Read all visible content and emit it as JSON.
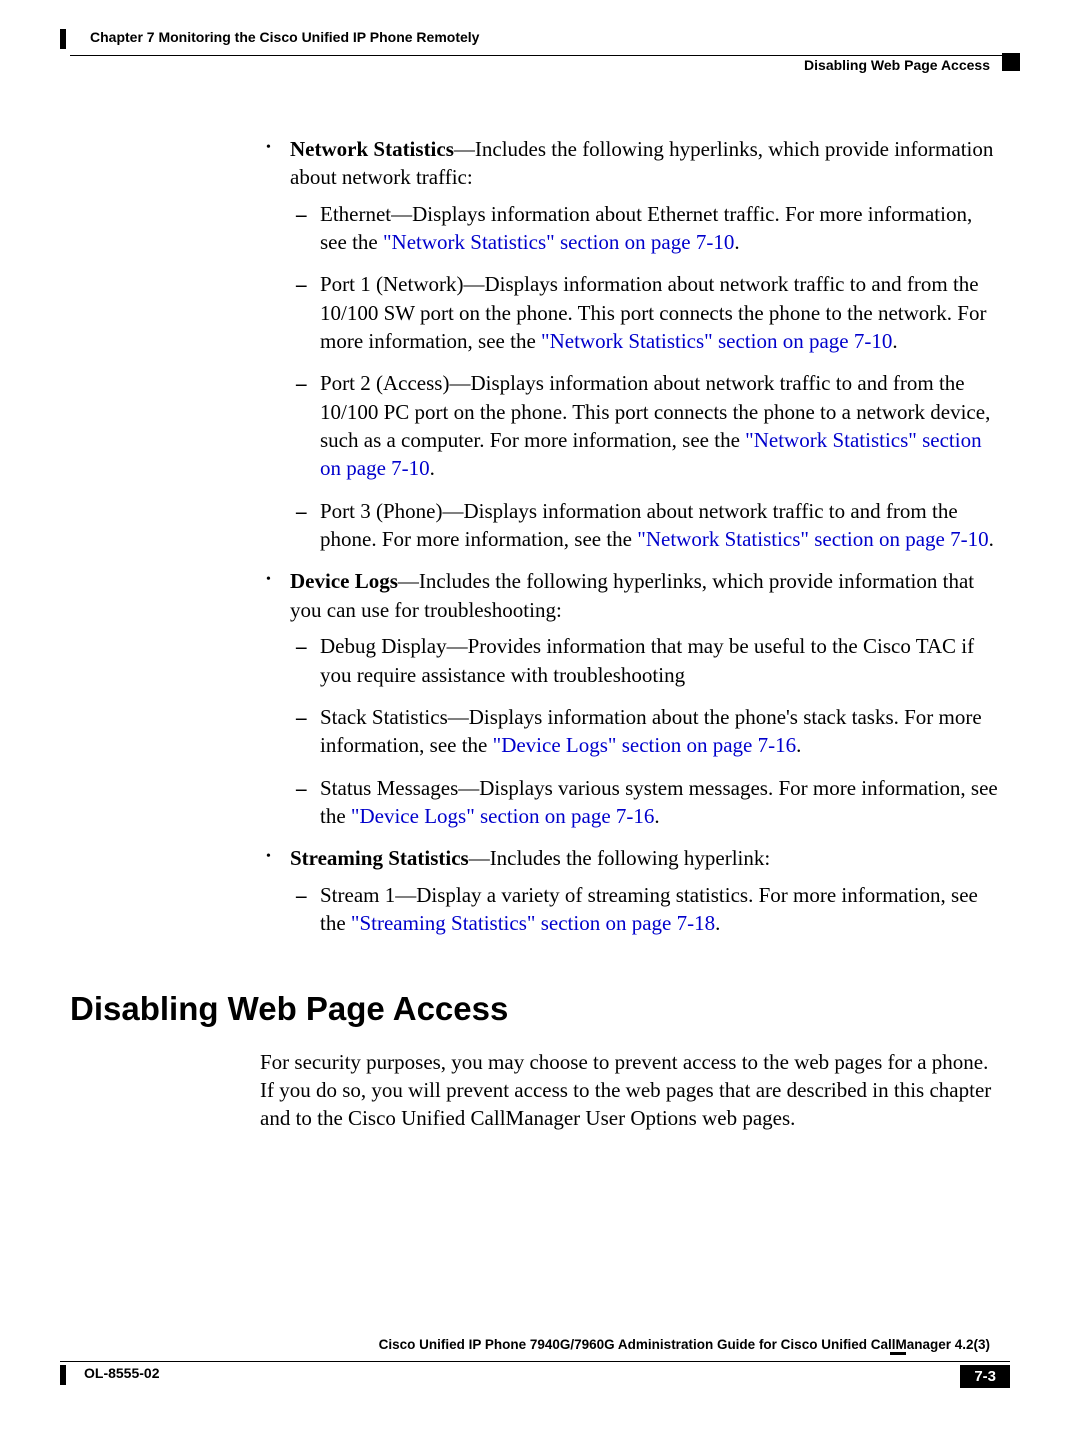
{
  "header": {
    "chapter": "Chapter 7      Monitoring the Cisco Unified IP Phone Remotely",
    "section": "Disabling Web Page Access"
  },
  "b1": {
    "title": "Network Statistics",
    "tail": "—Includes the following hyperlinks, which provide information about network traffic:",
    "s1a": "Ethernet—Displays information about Ethernet traffic. For more information, see the ",
    "s1l": "\"Network Statistics\" section on page 7-10",
    "s2a": "Port 1 (Network)—Displays information about network traffic to and from the 10/100 SW port on the phone. This port connects the phone to the network. For more information, see the ",
    "s2l": "\"Network Statistics\" section on page 7-10",
    "s3a": "Port 2 (Access)—Displays information about network traffic to and from the 10/100 PC port on the phone. This port connects the phone to a network device, such as a computer. For more information, see the ",
    "s3l": "\"Network Statistics\" section on page 7-10",
    "s4a": "Port 3 (Phone)—Displays information about network traffic to and from the phone. For more information, see the ",
    "s4l": "\"Network Statistics\" section on page 7-10"
  },
  "b2": {
    "title": "Device Logs",
    "tail": "—Includes the following hyperlinks, which provide information that you can use for troubleshooting:",
    "s1": "Debug Display—Provides information that may be useful to the Cisco TAC if you require assistance with troubleshooting",
    "s2a": "Stack Statistics—Displays information about the phone's stack tasks. For more information, see the ",
    "s2l": "\"Device Logs\" section on page 7-16",
    "s3a": "Status Messages—Displays various system messages. For more information, see the ",
    "s3l": "\"Device Logs\" section on page 7-16"
  },
  "b3": {
    "title": "Streaming Statistics",
    "tail": "—Includes the following hyperlink:",
    "s1a": "Stream 1—Display a variety of streaming statistics. For more information, see the ",
    "s1l": "\"Streaming Statistics\" section on page 7-18"
  },
  "sectionTitle": "Disabling Web Page Access",
  "sectionPara": "For security purposes, you may choose to prevent access to the web pages for a phone. If you do so, you will prevent access to the web pages that are described in this chapter and to the Cisco Unified CallManager User Options web pages.",
  "footer": {
    "guide": "Cisco Unified IP Phone 7940G/7960G Administration Guide for Cisco Unified CallManager 4.2(3)",
    "ol": "OL-8555-02",
    "page": "7-3"
  },
  "dot": "."
}
